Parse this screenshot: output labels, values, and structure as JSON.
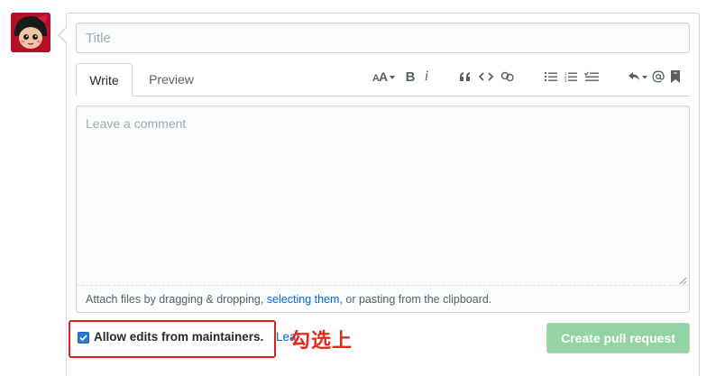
{
  "form": {
    "title_placeholder": "Title",
    "tabs": [
      {
        "label": "Write"
      },
      {
        "label": "Preview"
      }
    ],
    "toolbar": {
      "header_label": "AA",
      "bold_label": "B",
      "italic_label": "i",
      "quote_label": "“"
    },
    "comment_placeholder": "Leave a comment",
    "attach": {
      "prefix": "Attach files by dragging & dropping, ",
      "link": "selecting them",
      "suffix": ", or pasting from the clipboard."
    },
    "allow_edits_label": "Allow edits from maintainers.",
    "allow_edits_checked": true,
    "learn_more_label": "Learn more",
    "annotation": "勾选上",
    "create_button_label": "Create pull request"
  }
}
